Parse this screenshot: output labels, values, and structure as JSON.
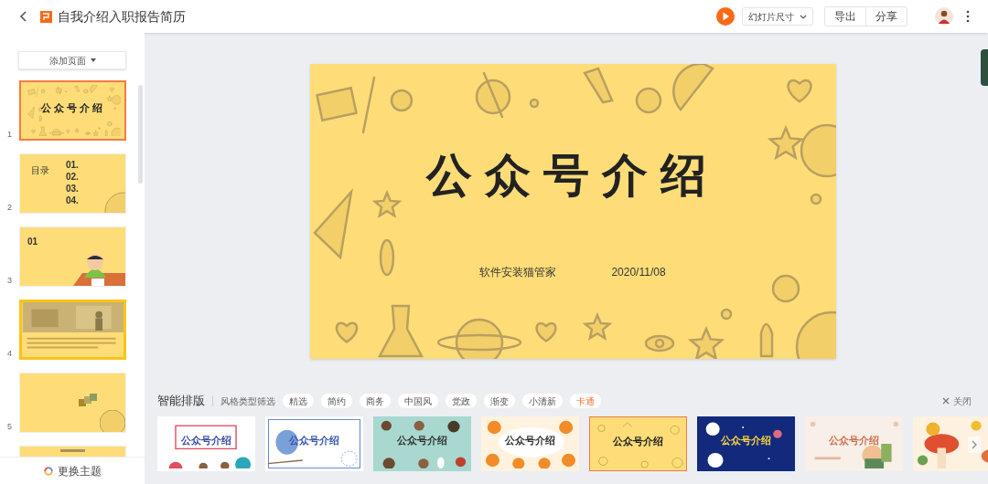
{
  "header": {
    "title": "自我介绍入职报告简历",
    "size_menu": "幻灯片尺寸",
    "buttons": [
      "导出",
      "分享"
    ]
  },
  "sidebar": {
    "add_page": "添加页面",
    "theme_button": "更换主题",
    "slides": [
      {
        "number": "1",
        "kind": "cover",
        "selected": true,
        "highlighted": false,
        "texts": [
          "公众号介绍"
        ]
      },
      {
        "number": "2",
        "kind": "contents",
        "selected": false,
        "highlighted": false,
        "texts": [
          "目录",
          "01.",
          "02.",
          "03.",
          "04."
        ]
      },
      {
        "number": "3",
        "kind": "figure",
        "selected": false,
        "highlighted": false,
        "texts": [
          "01"
        ]
      },
      {
        "number": "4",
        "selected": false,
        "highlighted": true
      },
      {
        "number": "5",
        "kind": "chart",
        "selected": false,
        "highlighted": false
      },
      {
        "kind": "plain",
        "selected": false,
        "highlighted": false
      }
    ]
  },
  "slide": {
    "title": "公众号介绍",
    "author": "软件安装猫管家",
    "date": "2020/11/08"
  },
  "layouts": {
    "title": "智能排版",
    "filter_label": "风格类型筛选",
    "close": "关闭",
    "filters": [
      {
        "label": "精选",
        "selected": false
      },
      {
        "label": "简约",
        "selected": false
      },
      {
        "label": "商务",
        "selected": false
      },
      {
        "label": "中国风",
        "selected": false
      },
      {
        "label": "党政",
        "selected": false
      },
      {
        "label": "渐变",
        "selected": false
      },
      {
        "label": "小清新",
        "selected": false
      },
      {
        "label": "卡通",
        "selected": true
      }
    ],
    "templates": [
      {
        "kind": "frame",
        "title": "公众号介绍",
        "selected": false
      },
      {
        "kind": "bird",
        "title": "公众号介绍",
        "selected": false
      },
      {
        "kind": "animals",
        "title": "公众号介绍",
        "selected": false
      },
      {
        "kind": "tigers",
        "title": "公众号介绍",
        "selected": false
      },
      {
        "kind": "doodle",
        "title": "公众号介绍",
        "selected": true
      },
      {
        "kind": "navy",
        "title": "公众号介绍",
        "selected": false
      },
      {
        "kind": "plain",
        "title": "公众号介绍",
        "selected": false
      },
      {
        "kind": "mushroom",
        "selected": false
      }
    ]
  }
}
